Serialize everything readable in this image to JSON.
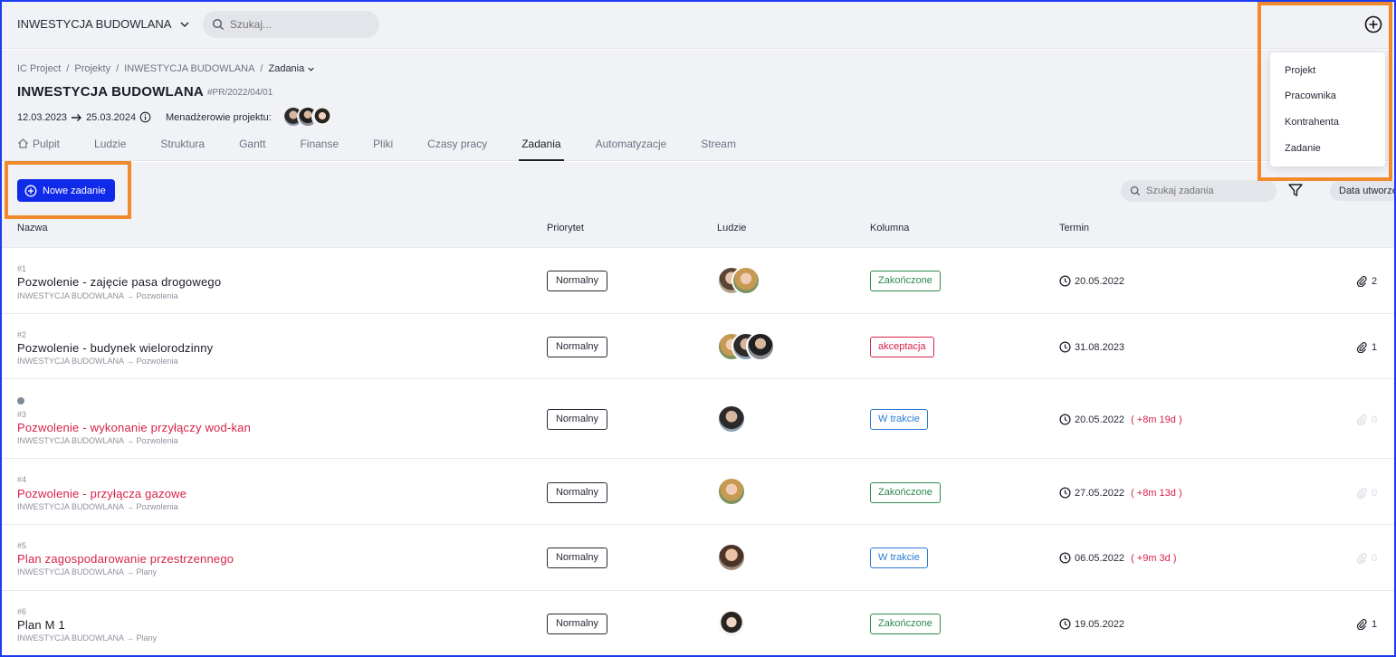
{
  "topbar": {
    "project_select": "INWESTYCJA BUDOWLANA",
    "search_placeholder": "Szukaj..."
  },
  "header": {
    "breadcrumbs": [
      "IC Project",
      "Projekty",
      "INWESTYCJA BUDOWLANA",
      "Zadania"
    ],
    "title": "INWESTYCJA BUDOWLANA",
    "code": "#PR/2022/04/01",
    "date_start": "12.03.2023",
    "date_end": "25.03.2024",
    "managers_label": "Menadżerowie projektu:",
    "tabs": [
      "Pulpit",
      "Ludzie",
      "Struktura",
      "Gantt",
      "Finanse",
      "Pliki",
      "Czasy pracy",
      "Zadania",
      "Automatyzacje",
      "Stream"
    ],
    "active_tab": "Zadania"
  },
  "toolbar": {
    "new_task_label": "Nowe zadanie",
    "search_placeholder": "Szukaj zadania",
    "sort_label": "Data utworzenia"
  },
  "columns": {
    "name": "Nazwa",
    "priority": "Priorytet",
    "people": "Ludzie",
    "column": "Kolumna",
    "due": "Termin"
  },
  "tasks": [
    {
      "num": "#1",
      "name": "Pozwolenie - zajęcie pasa drogowego",
      "path_project": "INWESTYCJA BUDOWLANA",
      "path_group": "Pozwolenia",
      "priority": "Normalny",
      "status": "Zakończone",
      "due": "20.05.2022",
      "late": "",
      "attachments": "2"
    },
    {
      "num": "#2",
      "name": "Pozwolenie - budynek wielorodzinny",
      "path_project": "INWESTYCJA BUDOWLANA",
      "path_group": "Pozwolenia",
      "priority": "Normalny",
      "status": "akceptacja",
      "due": "31.08.2023",
      "late": "",
      "attachments": "1"
    },
    {
      "num": "#3",
      "name": "Pozwolenie - wykonanie przyłączy wod-kan",
      "path_project": "INWESTYCJA BUDOWLANA",
      "path_group": "Pozwolenia",
      "priority": "Normalny",
      "status": "W trakcie",
      "due": "20.05.2022",
      "late": "( +8m 19d )",
      "attachments": "0"
    },
    {
      "num": "#4",
      "name": "Pozwolenie - przyłącza gazowe",
      "path_project": "INWESTYCJA BUDOWLANA",
      "path_group": "Pozwolenia",
      "priority": "Normalny",
      "status": "Zakończone",
      "due": "27.05.2022",
      "late": "( +8m 13d )",
      "attachments": "0"
    },
    {
      "num": "#5",
      "name": "Plan zagospodarowanie przestrzennego",
      "path_project": "INWESTYCJA BUDOWLANA",
      "path_group": "Plany",
      "priority": "Normalny",
      "status": "W trakcie",
      "due": "06.05.2022",
      "late": "( +9m 3d )",
      "attachments": "0"
    },
    {
      "num": "#6",
      "name": "Plan M 1",
      "path_project": "INWESTYCJA BUDOWLANA",
      "path_group": "Plany",
      "priority": "Normalny",
      "status": "Zakończone",
      "due": "19.05.2022",
      "late": "",
      "attachments": "1"
    }
  ],
  "add_menu": {
    "items": [
      "Projekt",
      "Pracownika",
      "Kontrahenta",
      "Zadanie"
    ]
  },
  "colors": {
    "accent": "#0f2ae8",
    "done": "#2c8a4c",
    "accept": "#d6224a",
    "in_progress": "#2a7ad6",
    "highlight": "#f08a2c"
  }
}
